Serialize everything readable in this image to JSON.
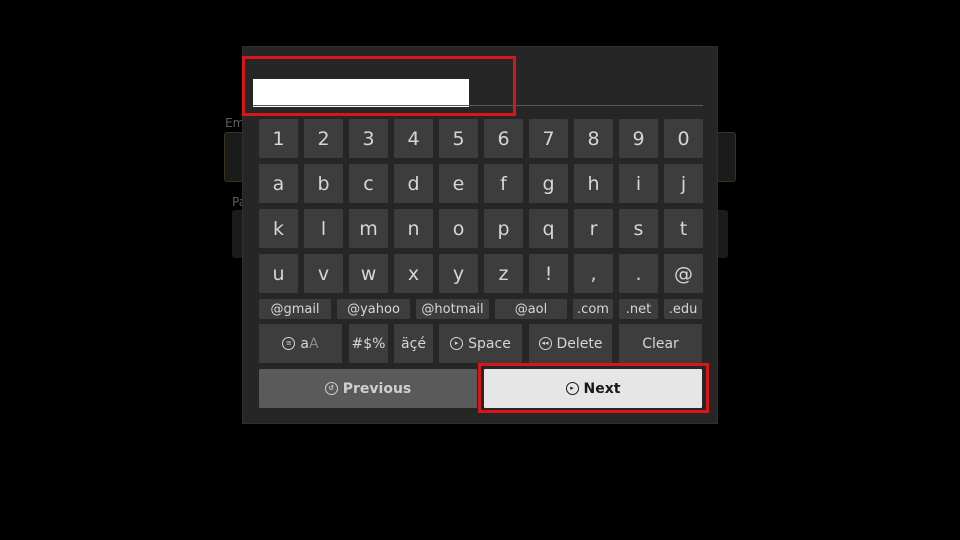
{
  "background_form": {
    "email_label": "Em",
    "password_label": "Pa"
  },
  "keyboard": {
    "input_value": "",
    "rows": [
      [
        "1",
        "2",
        "3",
        "4",
        "5",
        "6",
        "7",
        "8",
        "9",
        "0"
      ],
      [
        "a",
        "b",
        "c",
        "d",
        "e",
        "f",
        "g",
        "h",
        "i",
        "j"
      ],
      [
        "k",
        "l",
        "m",
        "n",
        "o",
        "p",
        "q",
        "r",
        "s",
        "t"
      ],
      [
        "u",
        "v",
        "w",
        "x",
        "y",
        "z",
        "!",
        ",",
        ".",
        "@"
      ]
    ],
    "domains": [
      "@gmail",
      "@yahoo",
      "@hotmail",
      "@aol",
      ".com",
      ".net",
      ".edu"
    ],
    "function_keys": {
      "case_main": "a",
      "case_sub": "A",
      "symbols": "#$%",
      "accents": "äçé",
      "space": "Space",
      "delete": "Delete",
      "clear": "Clear"
    },
    "previous_label": "Previous",
    "next_label": "Next"
  },
  "colors": {
    "highlight": "#d6161b",
    "key_bg": "#3d3d3d",
    "panel_bg": "#262626",
    "next_bg": "#e6e6e6"
  }
}
